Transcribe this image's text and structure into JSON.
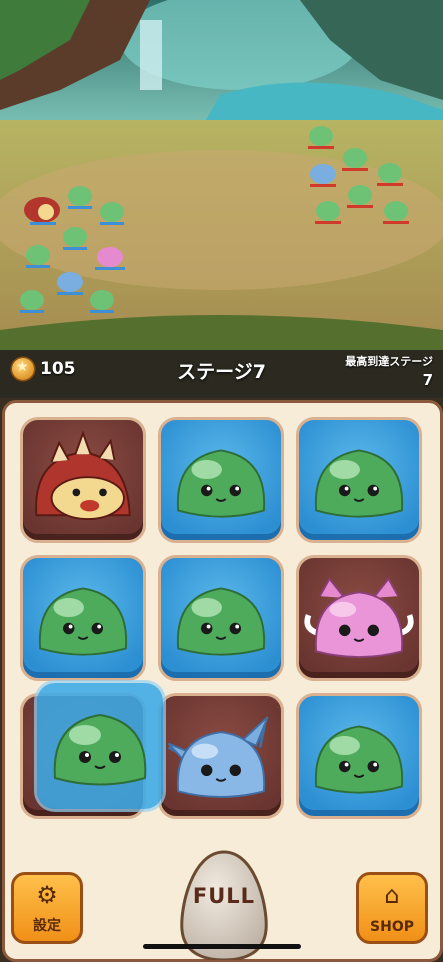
{
  "hud": {
    "coins": "105",
    "stage_title": "ステージ7",
    "best_label": "最高到達ステージ",
    "best_value": "7"
  },
  "grid": {
    "cells": [
      {
        "monster": "red-hedgehog",
        "frame": "brown"
      },
      {
        "monster": "green-slime",
        "frame": "blue"
      },
      {
        "monster": "green-slime",
        "frame": "blue"
      },
      {
        "monster": "green-slime",
        "frame": "blue"
      },
      {
        "monster": "green-slime",
        "frame": "blue"
      },
      {
        "monster": "pink-winged-slime",
        "frame": "brown"
      },
      {
        "monster": "green-slime",
        "frame": "blue",
        "state": "being-dragged"
      },
      {
        "monster": "blue-cat-slime",
        "frame": "brown"
      },
      {
        "monster": "green-slime",
        "frame": "blue"
      }
    ]
  },
  "buttons": {
    "settings_label": "設定",
    "settings_icon": "gear-icon",
    "shop_label": "SHOP",
    "shop_icon": "house-icon",
    "egg_label": "FULL"
  },
  "colors": {
    "panel_bg": "#f6ecd8",
    "panel_border": "#8b5a3c",
    "tile_blue": "#2c8fd2",
    "tile_brown": "#6a3530",
    "button_orange": "#f09018"
  }
}
